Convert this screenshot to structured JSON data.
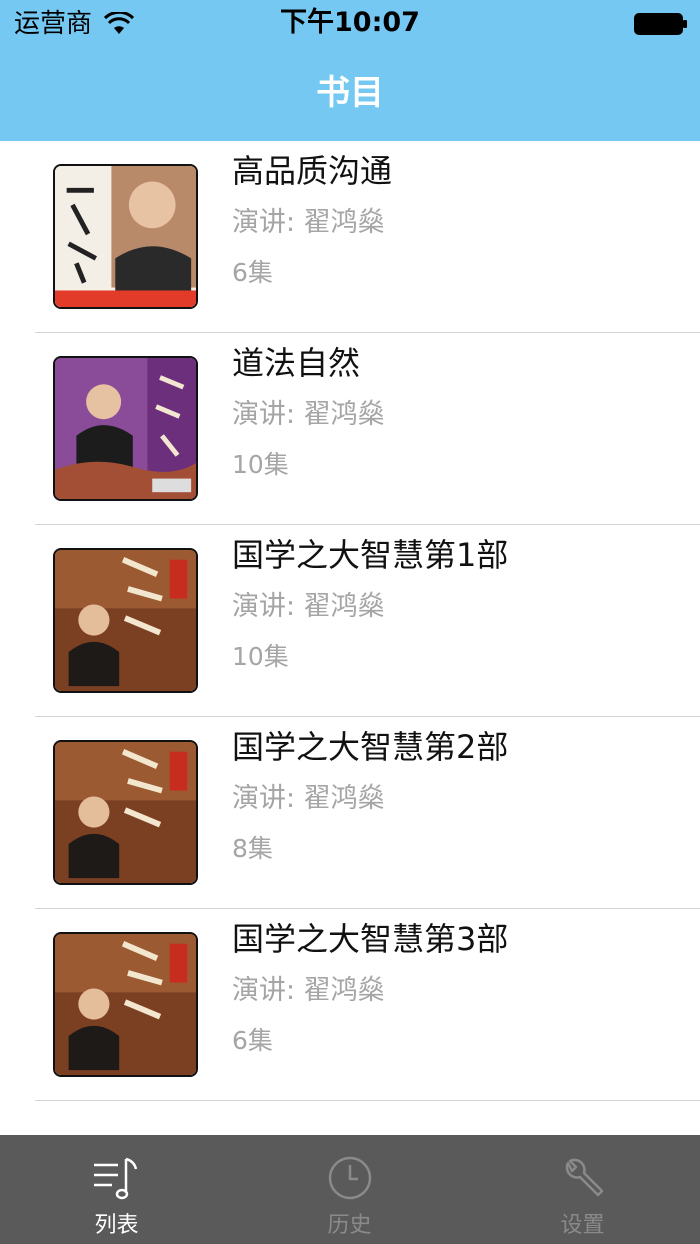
{
  "status_bar": {
    "carrier": "运营商",
    "time": "下午10:07",
    "icons": [
      "wifi-icon",
      "battery-icon"
    ]
  },
  "nav": {
    "title": "书目"
  },
  "books": [
    {
      "title": "高品质沟通",
      "speaker": "演讲: 翟鸿燊",
      "episodes": "6集",
      "cover_icon": "book-cover-image"
    },
    {
      "title": "道法自然",
      "speaker": "演讲: 翟鸿燊",
      "episodes": "10集",
      "cover_icon": "book-cover-image"
    },
    {
      "title": "国学之大智慧第1部",
      "speaker": "演讲: 翟鸿燊",
      "episodes": "10集",
      "cover_icon": "book-cover-image"
    },
    {
      "title": "国学之大智慧第2部",
      "speaker": "演讲: 翟鸿燊",
      "episodes": "8集",
      "cover_icon": "book-cover-image"
    },
    {
      "title": "国学之大智慧第3部",
      "speaker": "演讲: 翟鸿燊",
      "episodes": "6集",
      "cover_icon": "book-cover-image"
    }
  ],
  "tabbar": {
    "tabs": [
      {
        "label": "列表",
        "icon": "music-list-icon",
        "active": true
      },
      {
        "label": "历史",
        "icon": "clock-icon",
        "active": false
      },
      {
        "label": "设置",
        "icon": "wrench-icon",
        "active": false
      }
    ]
  },
  "colors": {
    "nav_background": "#75c8f2",
    "tabbar_background": "#5a5a5a",
    "secondary_text": "#a5a5a5",
    "active_tab": "#ffffff",
    "inactive_tab": "#8a8a8a"
  }
}
